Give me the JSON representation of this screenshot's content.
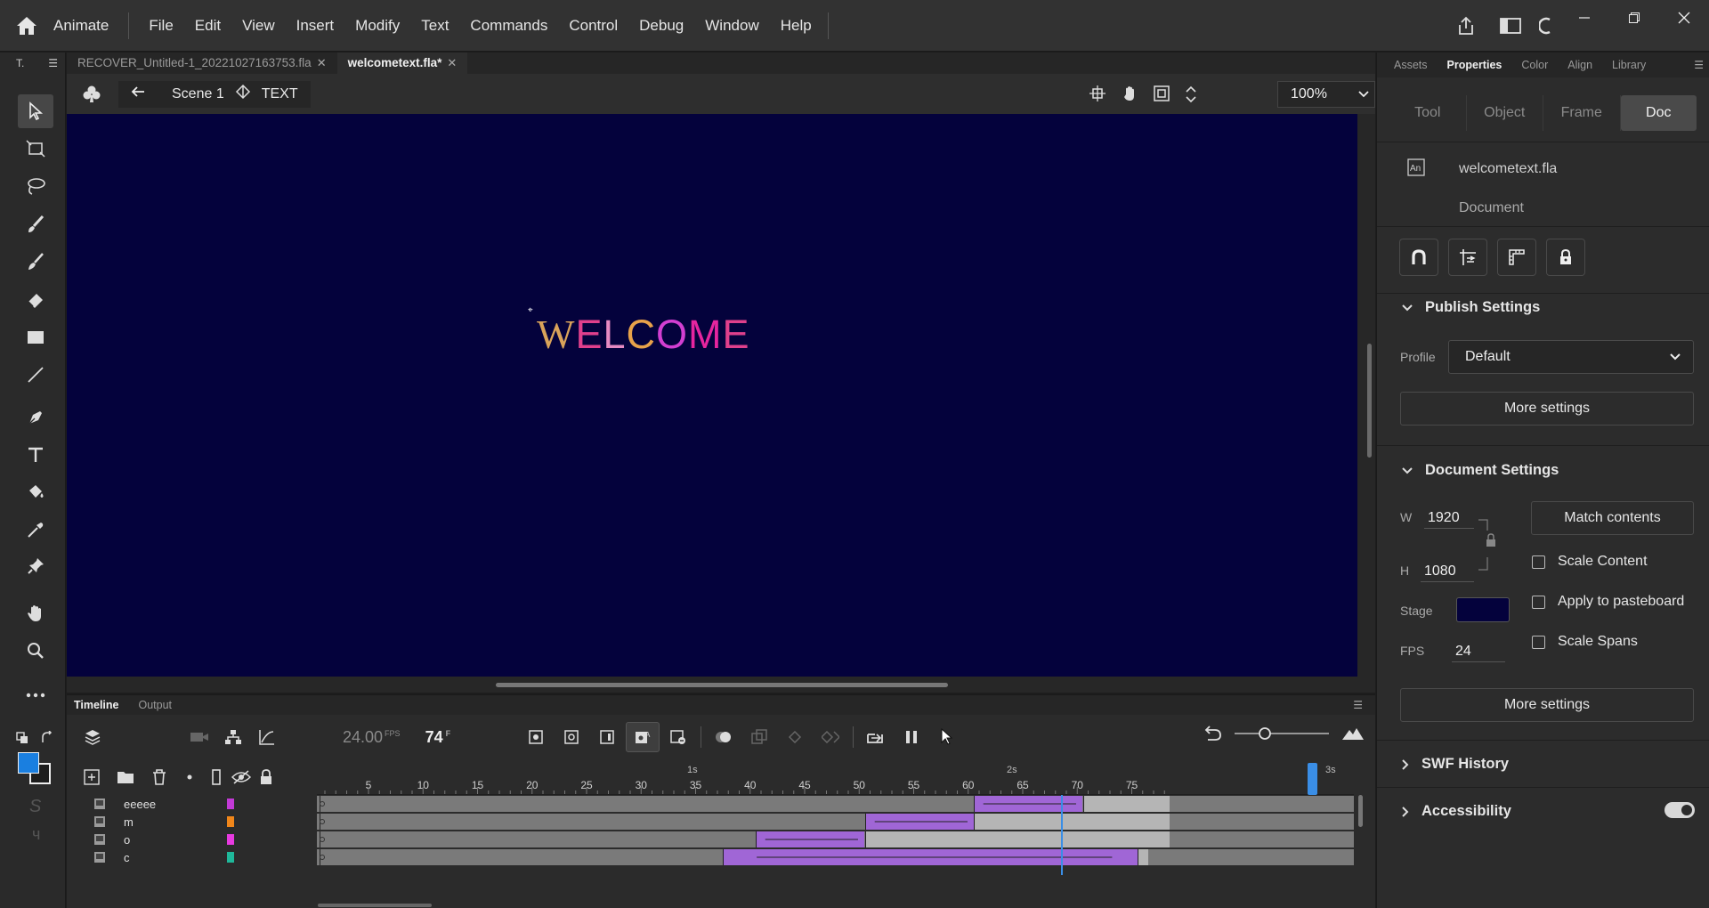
{
  "app": {
    "name": "Animate",
    "menu": [
      "File",
      "Edit",
      "View",
      "Insert",
      "Modify",
      "Text",
      "Commands",
      "Control",
      "Debug",
      "Window",
      "Help"
    ]
  },
  "doc_tabs": [
    {
      "label": "RECOVER_Untitled-1_20221027163753.fla",
      "active": false
    },
    {
      "label": "welcometext.fla*",
      "active": true
    }
  ],
  "editbar": {
    "scene": "Scene 1",
    "symbol": "TEXT",
    "zoom": "100%"
  },
  "tools_panel": {
    "label": "T."
  },
  "stage": {
    "background": "#04023c",
    "text_letters": [
      {
        "char": "W",
        "color": "#d9a35a"
      },
      {
        "char": "E",
        "color": "#e0408c"
      },
      {
        "char": "L",
        "color": "#e58ac2"
      },
      {
        "char": "C",
        "color": "#e8a24a"
      },
      {
        "char": "O",
        "color": "#d23fd1"
      },
      {
        "char": "M",
        "color": "#e6259f"
      },
      {
        "char": "E",
        "color": "#e0408c"
      }
    ]
  },
  "timeline": {
    "tabs": [
      "Timeline",
      "Output"
    ],
    "fps": "24.00",
    "fps_unit": "FPS",
    "current_frame": "74",
    "frame_unit": "F",
    "seconds": [
      "1s",
      "2s",
      "3s"
    ],
    "ticks": [
      "5",
      "10",
      "15",
      "20",
      "25",
      "30",
      "35",
      "40",
      "45",
      "50",
      "55",
      "60",
      "65",
      "70",
      "75"
    ],
    "layers": [
      {
        "name": "eeeee",
        "color": "#c23ad6"
      },
      {
        "name": "m",
        "color": "#f0861a"
      },
      {
        "name": "o",
        "color": "#e83ae0"
      },
      {
        "name": "c",
        "color": "#1fb89a"
      }
    ]
  },
  "properties": {
    "panel_tabs": [
      "Assets",
      "Properties",
      "Color",
      "Align",
      "Library"
    ],
    "subtabs": [
      "Tool",
      "Object",
      "Frame",
      "Doc"
    ],
    "file_name": "welcometext.fla",
    "file_type": "Document",
    "publish_settings": {
      "title": "Publish Settings",
      "profile_label": "Profile",
      "profile_value": "Default",
      "more_label": "More settings"
    },
    "document_settings": {
      "title": "Document Settings",
      "w_label": "W",
      "w_value": "1920",
      "h_label": "H",
      "h_value": "1080",
      "match_contents": "Match contents",
      "scale_content": "Scale Content",
      "apply_pasteboard": "Apply to pasteboard",
      "stage_label": "Stage",
      "stage_color": "#04023c",
      "fps_label": "FPS",
      "fps_value": "24",
      "scale_spans": "Scale Spans",
      "more_label": "More settings"
    },
    "swf_history": "SWF History",
    "accessibility": "Accessibility"
  }
}
